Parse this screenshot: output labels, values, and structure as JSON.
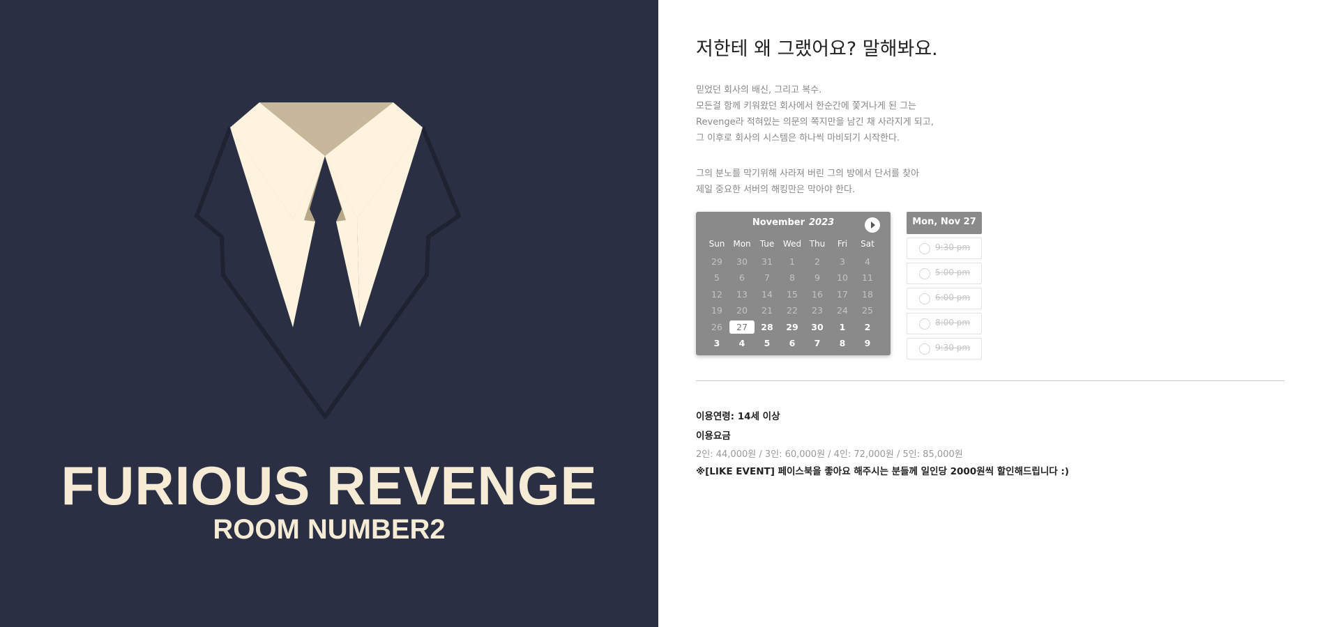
{
  "poster": {
    "title": "FURIOUS REVENGE",
    "subtitle": "ROOM NUMBER2",
    "colors": {
      "background": "#2b2f43",
      "collar": "#fdf3df",
      "collar_shadow": "#c8b89b",
      "outline": "#1e2231"
    }
  },
  "headline": "저한테 왜 그랬어요? 말해봐요.",
  "description": {
    "p1": [
      "믿었던 회사의 배신, 그리고 복수.",
      "모든걸 함께 키워왔던 회사에서 한순간에 쫓겨나게 된 그는",
      "Revenge라 적혀있는 의문의 쪽지만을 남긴 채 사라지게 되고,",
      "그 이후로 회사의 시스템은 하나씩 마비되기 시작한다."
    ],
    "p2": [
      "그의 분노를 막기위해 사라져 버린 그의 방에서 단서를 찾아",
      "제일 중요한 서버의 해킹만은 막아야 한다."
    ]
  },
  "calendar": {
    "month": "November",
    "year": "2023",
    "weekdays": [
      "Sun",
      "Mon",
      "Tue",
      "Wed",
      "Thu",
      "Fri",
      "Sat"
    ],
    "days": [
      "29",
      "30",
      "31",
      "1",
      "2",
      "3",
      "4",
      "5",
      "6",
      "7",
      "8",
      "9",
      "10",
      "11",
      "12",
      "13",
      "14",
      "15",
      "16",
      "17",
      "18",
      "19",
      "20",
      "21",
      "22",
      "23",
      "24",
      "25",
      "26",
      "27",
      "28",
      "29",
      "30",
      "1",
      "2",
      "3",
      "4",
      "5",
      "6",
      "7",
      "8",
      "9"
    ],
    "selected_index": 29,
    "available_from_index": 30,
    "colors": {
      "panel": "#8a8a8a",
      "disabled": "#c4c4c4"
    }
  },
  "slots": {
    "date_label": "Mon, Nov 27",
    "times": [
      "9:30 pm",
      "5:00 pm",
      "6:00 pm",
      "8:00 pm",
      "9:30 pm"
    ]
  },
  "info": {
    "age": "이용연령: 14세 이상",
    "fee_label": "이용요금",
    "fee": "2인: 44,000원 / 3인: 60,000원 / 4인: 72,000원 / 5인: 85,000원",
    "event": "※[LIKE EVENT] 페이스북을 좋아요 해주시는 분들께 일인당 2000원씩 할인해드립니다 :)"
  }
}
